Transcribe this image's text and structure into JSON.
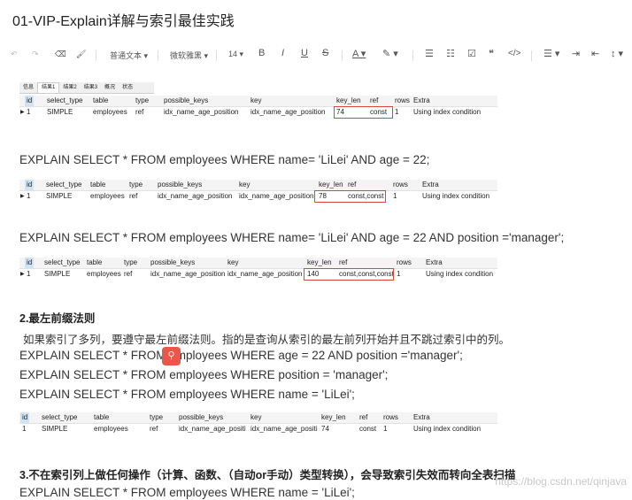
{
  "title": "01-VIP-Explain详解与索引最佳实践",
  "toolbar": {
    "undo": "↶",
    "redo": "↷",
    "eraser": "⌫",
    "format_painter": "🖌",
    "paragraph": "普通文本 ▾",
    "font": "微软雅黑 ▾",
    "size": "14 ▾",
    "bold": "B",
    "italic": "I",
    "underline": "U",
    "strike": "S",
    "font_color": "A ▾",
    "highlight": "✎ ▾",
    "bullet_list": "☰",
    "numbered_list": "☷",
    "checkbox": "☑",
    "quote": "❝",
    "code": "</>",
    "align": "☰ ▾",
    "indent": "⇥",
    "outdent": "⇤",
    "line_height": "↕ ▾"
  },
  "result_tabs": [
    "信息",
    "结果1",
    "结果2",
    "结果3",
    "概况",
    "状态"
  ],
  "columns": [
    "id",
    "select_type",
    "table",
    "type",
    "possible_keys",
    "key",
    "key_len",
    "ref",
    "rows",
    "Extra"
  ],
  "tables": [
    {
      "row": [
        "1",
        "SIMPLE",
        "employees",
        "ref",
        "idx_name_age_position",
        "idx_name_age_position",
        "74",
        "const",
        "1",
        "Using index condition"
      ]
    },
    {
      "row": [
        "1",
        "SIMPLE",
        "employees",
        "ref",
        "idx_name_age_position",
        "idx_name_age_position",
        "78",
        "const,const",
        "1",
        "Using index condition"
      ]
    },
    {
      "row": [
        "1",
        "SIMPLE",
        "employees",
        "ref",
        "idx_name_age_position",
        "idx_name_age_position",
        "140",
        "const,const,const",
        "1",
        "Using index condition"
      ]
    },
    {
      "row": [
        "1",
        "SIMPLE",
        "employees",
        "ref",
        "idx_name_age_positi",
        "idx_name_age_positi",
        "74",
        "const",
        "1",
        "Using index condition"
      ]
    }
  ],
  "sql1": "EXPLAIN SELECT * FROM employees WHERE name= 'LiLei' AND age = 22;",
  "sql2": "EXPLAIN SELECT * FROM employees WHERE  name= 'LiLei' AND  age = 22 AND position ='manager';",
  "section2": {
    "heading": "2.最左前缀法则",
    "desc": "如果索引了多列，要遵守最左前缀法则。指的是查询从索引的最左前列开始并且不跳过索引中的列。",
    "sql": [
      "EXPLAIN SELECT * FROM employees WHERE age = 22 AND position ='manager';",
      "EXPLAIN SELECT * FROM employees WHERE position = 'manager';",
      "EXPLAIN SELECT * FROM employees WHERE name = 'LiLei';"
    ]
  },
  "section3": {
    "heading": "3.不在索引列上做任何操作（计算、函数、（自动or手动）类型转换），会导致索引失效而转向全表扫描",
    "sql": "EXPLAIN SELECT * FROM employees WHERE name = 'LiLei';"
  },
  "watermark": "https://blog.csdn.net/qinjava",
  "accent": "#d9463a"
}
